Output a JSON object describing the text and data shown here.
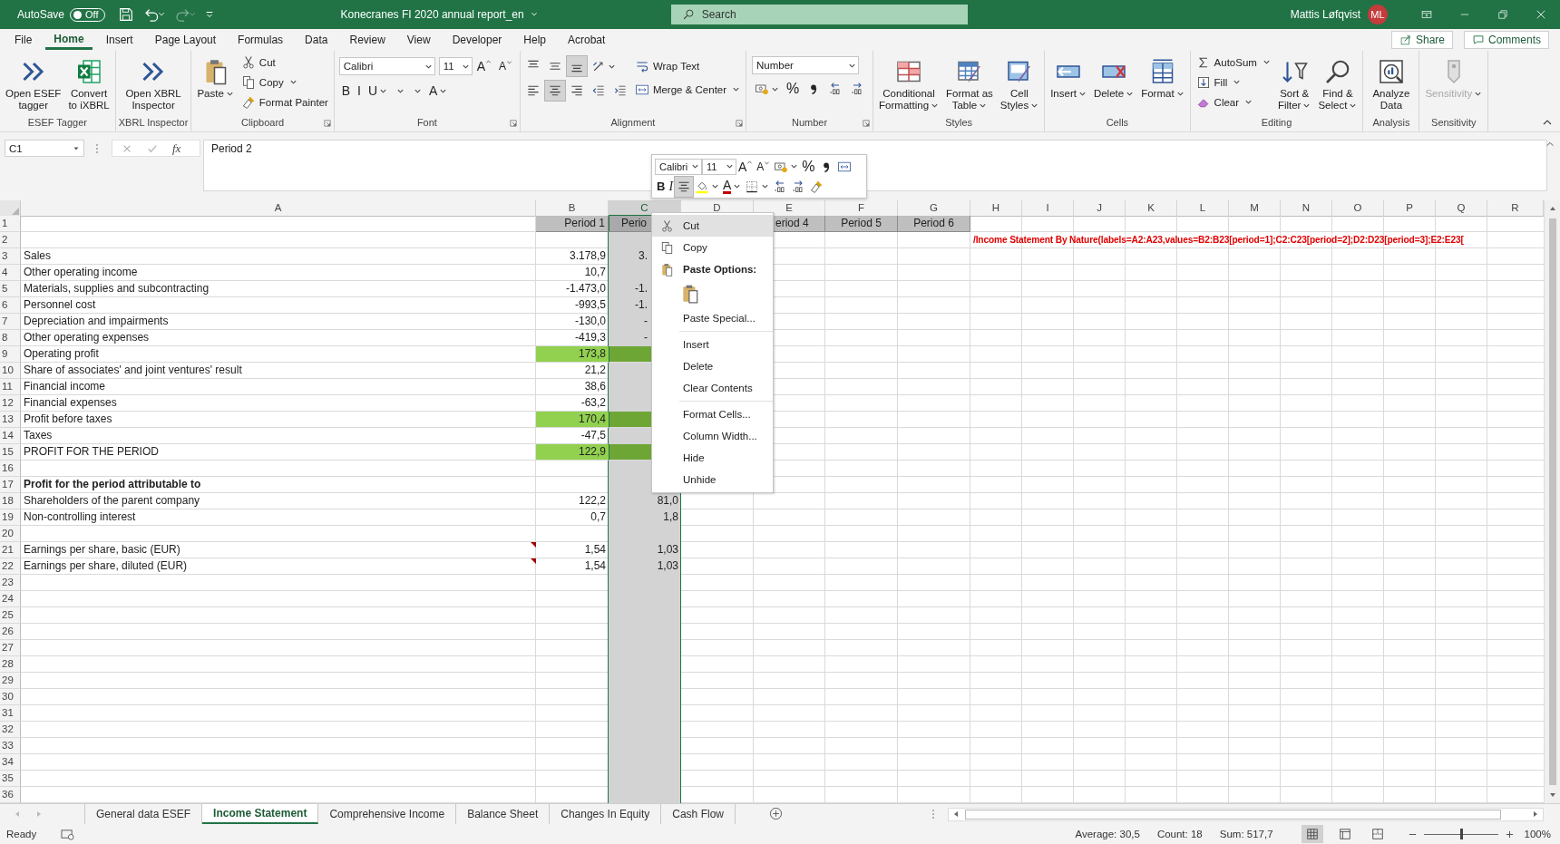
{
  "title_bar": {
    "autosave_label": "AutoSave",
    "autosave_toggle": {
      "label": "Off",
      "on": false
    },
    "title": "Konecranes FI 2020 annual report_en",
    "search": {
      "placeholder": "Search"
    },
    "user": "Mattis Løfqvist",
    "avatar": "ML"
  },
  "ribbon_tabs": [
    {
      "label": "File",
      "selected": false
    },
    {
      "label": "Home",
      "selected": true
    },
    {
      "label": "Insert",
      "selected": false
    },
    {
      "label": "Page Layout",
      "selected": false
    },
    {
      "label": "Formulas",
      "selected": false
    },
    {
      "label": "Data",
      "selected": false
    },
    {
      "label": "Review",
      "selected": false
    },
    {
      "label": "View",
      "selected": false
    },
    {
      "label": "Developer",
      "selected": false
    },
    {
      "label": "Help",
      "selected": false
    },
    {
      "label": "Acrobat",
      "selected": false
    }
  ],
  "share": "Share",
  "comments": "Comments",
  "ribbon_groups": [
    {
      "label": "ESEF Tagger",
      "launcher": false,
      "stacks": [
        [
          [
            {
              "kind": "large",
              "label": "Open ESEF\ntagger"
            }
          ]
        ],
        [
          [
            {
              "kind": "large",
              "label": "Convert\nto iXBRL"
            }
          ]
        ]
      ]
    },
    {
      "label": "XBRL Inspector",
      "launcher": false,
      "stacks": [
        [
          [
            {
              "kind": "large",
              "label": "Open XBRL\nInspector"
            }
          ]
        ]
      ]
    },
    {
      "label": "Clipboard",
      "launcher": true,
      "stacks": [
        [
          [
            {
              "kind": "large",
              "label": "Paste",
              "menu": true
            }
          ]
        ],
        [
          [
            {
              "kind": "small",
              "label": "Cut"
            }
          ],
          [
            {
              "kind": "small",
              "label": "Copy",
              "menu": true
            }
          ],
          [
            {
              "kind": "small",
              "label": "Format Painter"
            }
          ]
        ]
      ]
    },
    {
      "label": "Font",
      "launcher": true,
      "stacks": [
        [
          [
            {
              "kind": "field",
              "value": "Calibri"
            },
            {
              "kind": "field",
              "value": "11"
            },
            {
              "kind": "glyph",
              "label": "A"
            },
            {
              "kind": "glyph",
              "label": "A"
            }
          ],
          [
            {
              "kind": "glyph",
              "label": "B"
            },
            {
              "kind": "glyph",
              "label": "I"
            },
            {
              "kind": "glyph",
              "label": "U",
              "menu": true
            },
            {
              "kind": "icon",
              "menu": true
            },
            {
              "kind": "icon",
              "menu": true
            },
            {
              "kind": "glyph",
              "label": "A",
              "menu": true
            }
          ]
        ]
      ]
    },
    {
      "label": "Alignment",
      "launcher": true,
      "stacks": [
        [
          [
            {
              "kind": "icon",
              "selected": false
            },
            {
              "kind": "icon",
              "selected": false
            },
            {
              "kind": "icon",
              "selected": true
            },
            {
              "kind": "icon",
              "menu": true
            }
          ],
          [
            {
              "kind": "icon",
              "selected": false
            },
            {
              "kind": "icon",
              "selected": true
            },
            {
              "kind": "icon",
              "selected": false
            },
            {
              "kind": "icon"
            },
            {
              "kind": "icon"
            }
          ]
        ],
        [
          [
            {
              "kind": "small",
              "label": "Wrap Text"
            }
          ],
          [
            {
              "kind": "small",
              "label": "Merge & Center",
              "menu": true
            }
          ]
        ]
      ]
    },
    {
      "label": "Number",
      "launcher": true,
      "stacks": [
        [
          [
            {
              "kind": "field",
              "value": "Number"
            }
          ],
          [
            {
              "kind": "icon",
              "menu": true
            },
            {
              "kind": "glyph",
              "label": "%"
            },
            {
              "kind": "icon"
            },
            {
              "kind": "icon"
            },
            {
              "kind": "icon"
            }
          ]
        ]
      ]
    },
    {
      "label": "Styles",
      "launcher": false,
      "stacks": [
        [
          [
            {
              "kind": "large",
              "label": "Conditional\nFormatting",
              "menu": true
            }
          ]
        ],
        [
          [
            {
              "kind": "large",
              "label": "Format as\nTable",
              "menu": true
            }
          ]
        ],
        [
          [
            {
              "kind": "large",
              "label": "Cell\nStyles",
              "menu": true
            }
          ]
        ]
      ]
    },
    {
      "label": "Cells",
      "launcher": false,
      "stacks": [
        [
          [
            {
              "kind": "large",
              "label": "Insert",
              "menu": true
            }
          ]
        ],
        [
          [
            {
              "kind": "large",
              "label": "Delete",
              "menu": true
            }
          ]
        ],
        [
          [
            {
              "kind": "large",
              "label": "Format",
              "menu": true
            }
          ]
        ]
      ]
    },
    {
      "label": "Editing",
      "launcher": false,
      "stacks": [
        [
          [
            {
              "kind": "small",
              "label": "AutoSum",
              "menu": true
            }
          ],
          [
            {
              "kind": "small",
              "label": "Fill",
              "menu": true
            }
          ],
          [
            {
              "kind": "small",
              "label": "Clear",
              "menu": true
            }
          ]
        ],
        [
          [
            {
              "kind": "large",
              "label": "Sort &\nFilter",
              "menu": true
            }
          ]
        ],
        [
          [
            {
              "kind": "large",
              "label": "Find &\nSelect",
              "menu": true
            }
          ]
        ]
      ]
    },
    {
      "label": "Analysis",
      "launcher": false,
      "stacks": [
        [
          [
            {
              "kind": "large",
              "label": "Analyze\nData"
            }
          ]
        ]
      ]
    },
    {
      "label": "Sensitivity",
      "launcher": false,
      "stacks": [
        [
          [
            {
              "kind": "large",
              "label": "Sensitivity",
              "menu": true,
              "disabled": true
            }
          ]
        ]
      ]
    }
  ],
  "mini_toolbar": {
    "font_row": [
      {
        "kind": "field",
        "value": "Calibri"
      },
      {
        "kind": "field",
        "value": "11"
      },
      {
        "kind": "glyph",
        "label": "A"
      },
      {
        "kind": "glyph",
        "label": "A"
      },
      {
        "kind": "icon",
        "menu": true
      },
      {
        "kind": "glyph",
        "label": "%"
      },
      {
        "kind": "icon"
      },
      {
        "kind": "icon"
      }
    ],
    "format_row": [
      {
        "kind": "glyph",
        "label": "B"
      },
      {
        "kind": "glyph",
        "label": "I"
      },
      {
        "kind": "icon",
        "selected": true
      },
      {
        "kind": "icon",
        "menu": true
      },
      {
        "kind": "glyph",
        "label": "A",
        "menu": true
      },
      {
        "kind": "icon",
        "menu": true
      },
      {
        "kind": "icon"
      },
      {
        "kind": "icon"
      },
      {
        "kind": "icon"
      }
    ]
  },
  "formula_bar": {
    "name_box": "C1",
    "function_label": "fx",
    "formula": "Period 2"
  },
  "columns": [
    {
      "label": "A",
      "selected": false
    },
    {
      "label": "B",
      "selected": false
    },
    {
      "label": "C",
      "selected": true
    },
    {
      "label": "D",
      "selected": false
    },
    {
      "label": "E",
      "selected": false
    },
    {
      "label": "F",
      "selected": false
    },
    {
      "label": "G",
      "selected": false
    },
    {
      "label": "H",
      "selected": false
    },
    {
      "label": "I",
      "selected": false
    },
    {
      "label": "J",
      "selected": false
    },
    {
      "label": "K",
      "selected": false
    },
    {
      "label": "L",
      "selected": false
    },
    {
      "label": "M",
      "selected": false
    },
    {
      "label": "N",
      "selected": false
    },
    {
      "label": "O",
      "selected": false
    },
    {
      "label": "P",
      "selected": false
    },
    {
      "label": "Q",
      "selected": false
    },
    {
      "label": "R",
      "selected": false
    }
  ],
  "rows": [
    {
      "num": "1",
      "kind": "header",
      "b": "Period 1",
      "c": "Perio",
      "e": "eriod 4",
      "f": "Period 5",
      "g": "Period 6",
      "note": false
    },
    {
      "num": "2",
      "kind": "plain",
      "h": "/Income Statement By Nature(labels=A2:A23,values=B2:B23[period=1];C2:C23[period=2];D2:D23[period=3];E2:E23[",
      "note": false
    },
    {
      "num": "3",
      "kind": "plain",
      "a": "Sales",
      "b": "3.178,9",
      "c": "3.",
      "note": false
    },
    {
      "num": "4",
      "kind": "plain",
      "a": "Other operating income",
      "b": "10,7",
      "note": false
    },
    {
      "num": "5",
      "kind": "plain",
      "a": "Materials, supplies and subcontracting",
      "b": "-1.473,0",
      "c": "-1.",
      "note": false
    },
    {
      "num": "6",
      "kind": "plain",
      "a": "Personnel cost",
      "b": "-993,5",
      "c": "-1.",
      "note": false
    },
    {
      "num": "7",
      "kind": "plain",
      "a": "Depreciation and impairments",
      "b": "-130,0",
      "c": "-",
      "note": false
    },
    {
      "num": "8",
      "kind": "plain",
      "a": "Other operating expenses",
      "b": "-419,3",
      "c": "-",
      "note": false
    },
    {
      "num": "9",
      "kind": "highlight",
      "a": "Operating profit",
      "b": "173,8",
      "note": false
    },
    {
      "num": "10",
      "kind": "plain",
      "a": "Share of associates' and joint ventures' result",
      "b": "21,2",
      "note": false
    },
    {
      "num": "11",
      "kind": "plain",
      "a": "Financial income",
      "b": "38,6",
      "note": false
    },
    {
      "num": "12",
      "kind": "plain",
      "a": "Financial expenses",
      "b": "-63,2",
      "note": false
    },
    {
      "num": "13",
      "kind": "highlight",
      "a": "Profit before taxes",
      "b": "170,4",
      "note": false
    },
    {
      "num": "14",
      "kind": "plain",
      "a": "Taxes",
      "b": "-47,5",
      "note": false
    },
    {
      "num": "15",
      "kind": "highlight",
      "a": "PROFIT FOR THE PERIOD",
      "b": "122,9",
      "note": false
    },
    {
      "num": "16",
      "kind": "plain",
      "note": false
    },
    {
      "num": "17",
      "kind": "plain",
      "a": "Profit for the period attributable to",
      "bold": true,
      "note": false
    },
    {
      "num": "18",
      "kind": "plain",
      "a": "Shareholders of the parent company",
      "b": "122,2",
      "c": "81,0",
      "note": false
    },
    {
      "num": "19",
      "kind": "plain",
      "a": "Non-controlling interest",
      "b": "0,7",
      "c": "1,8",
      "note": false
    },
    {
      "num": "20",
      "kind": "plain",
      "note": false
    },
    {
      "num": "21",
      "kind": "plain",
      "a": "Earnings per share, basic (EUR)",
      "b": "1,54",
      "c": "1,03",
      "note": true
    },
    {
      "num": "22",
      "kind": "plain",
      "a": "Earnings per share, diluted (EUR)",
      "b": "1,54",
      "c": "1,03",
      "note": true
    },
    {
      "num": "23",
      "kind": "plain",
      "note": false
    },
    {
      "num": "24",
      "kind": "plain",
      "note": false
    },
    {
      "num": "25",
      "kind": "plain",
      "note": false
    },
    {
      "num": "26",
      "kind": "plain",
      "note": false
    },
    {
      "num": "27",
      "kind": "plain",
      "note": false
    },
    {
      "num": "28",
      "kind": "plain",
      "note": false
    },
    {
      "num": "29",
      "kind": "plain",
      "note": false
    },
    {
      "num": "30",
      "kind": "plain",
      "note": false
    },
    {
      "num": "31",
      "kind": "plain",
      "note": false
    },
    {
      "num": "32",
      "kind": "plain",
      "note": false
    },
    {
      "num": "33",
      "kind": "plain",
      "note": false
    },
    {
      "num": "34",
      "kind": "plain",
      "note": false
    },
    {
      "num": "35",
      "kind": "plain",
      "note": false
    },
    {
      "num": "36",
      "kind": "plain",
      "note": false
    }
  ],
  "context_menu": [
    {
      "kind": "item",
      "label": "Cut",
      "selected": true
    },
    {
      "kind": "item",
      "label": "Copy",
      "selected": false
    },
    {
      "kind": "header",
      "label": "Paste Options:"
    },
    {
      "kind": "paste-icon"
    },
    {
      "kind": "item",
      "label": "Paste Special...",
      "selected": false
    },
    {
      "kind": "separator"
    },
    {
      "kind": "item",
      "label": "Insert",
      "selected": false
    },
    {
      "kind": "item",
      "label": "Delete",
      "selected": false
    },
    {
      "kind": "item",
      "label": "Clear Contents",
      "selected": false
    },
    {
      "kind": "separator"
    },
    {
      "kind": "item",
      "label": "Format Cells...",
      "selected": false
    },
    {
      "kind": "item",
      "label": "Column Width...",
      "selected": false
    },
    {
      "kind": "item",
      "label": "Hide",
      "selected": false
    },
    {
      "kind": "item",
      "label": "Unhide",
      "selected": false
    }
  ],
  "sheet_tabs": [
    {
      "label": "General data ESEF",
      "selected": false
    },
    {
      "label": "Income Statement",
      "selected": true
    },
    {
      "label": "Comprehensive Income",
      "selected": false
    },
    {
      "label": "Balance Sheet",
      "selected": false
    },
    {
      "label": "Changes In Equity",
      "selected": false
    },
    {
      "label": "Cash Flow",
      "selected": false
    }
  ],
  "status_bar": {
    "status": "Ready",
    "average": "Average: 30,5",
    "count": "Count: 18",
    "sum": "Sum: 517,7",
    "views": [
      {
        "selected": true
      },
      {
        "selected": false
      },
      {
        "selected": false
      }
    ],
    "zoom": {
      "level": 0.5,
      "label": "100%"
    }
  }
}
